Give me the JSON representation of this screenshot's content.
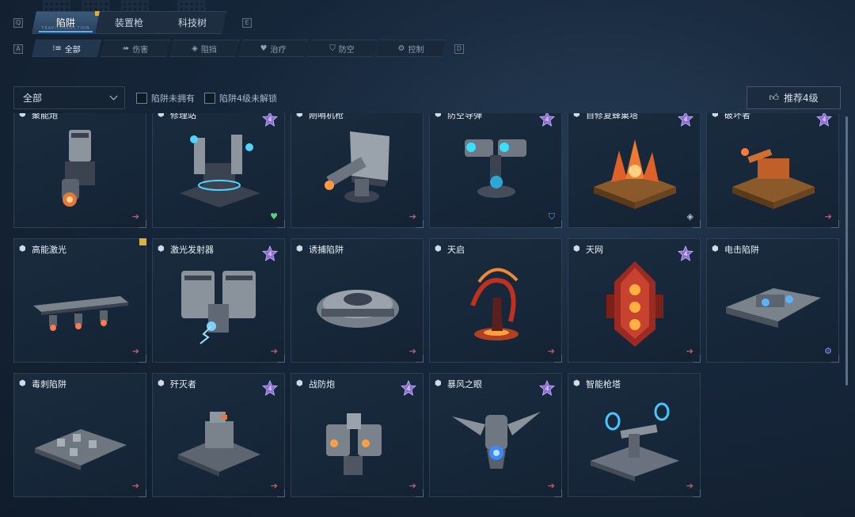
{
  "tabs": {
    "left_key": "Q",
    "right_key": "E",
    "items": [
      {
        "label": "陷阱",
        "sub": "TRAP/COLLECTION",
        "active": true,
        "badge": true
      },
      {
        "label": "装置枪",
        "sub": "",
        "active": false,
        "badge": false
      },
      {
        "label": "科技树",
        "sub": "",
        "active": false,
        "badge": false
      }
    ]
  },
  "filters": {
    "left_key": "A",
    "right_key": "D",
    "items": [
      {
        "label": "全部",
        "icon": "grid-icon",
        "glyph": "⁝≡",
        "active": true
      },
      {
        "label": "伤害",
        "icon": "damage-icon",
        "glyph": "➠",
        "active": false
      },
      {
        "label": "阻挡",
        "icon": "block-icon",
        "glyph": "◈",
        "active": false
      },
      {
        "label": "治疗",
        "icon": "heal-icon",
        "glyph": "♥",
        "active": false
      },
      {
        "label": "防空",
        "icon": "antiair-icon",
        "glyph": "⛉",
        "active": false
      },
      {
        "label": "控制",
        "icon": "control-icon",
        "glyph": "⚙",
        "active": false
      }
    ]
  },
  "toolbar": {
    "select_value": "全部",
    "check_not_owned": "陷阱未拥有",
    "check_level4_locked": "陷阱4级未解锁",
    "recommend_label": "推荐4级"
  },
  "cards": [
    {
      "name": "聚能炮",
      "star": false,
      "foot": "damage",
      "art": "cannon"
    },
    {
      "name": "修理站",
      "star": true,
      "foot": "heal",
      "art": "repair"
    },
    {
      "name": "刚哨机枪",
      "star": false,
      "foot": "damage",
      "art": "gun"
    },
    {
      "name": "防空导弹",
      "star": true,
      "foot": "antiair",
      "art": "missile"
    },
    {
      "name": "自修复蜂巢塔",
      "star": true,
      "foot": "block",
      "art": "hive"
    },
    {
      "name": "破坏者",
      "star": true,
      "foot": "damage",
      "art": "destroyer"
    },
    {
      "name": "高能激光",
      "star": false,
      "foot": "damage",
      "art": "laser",
      "new": true
    },
    {
      "name": "激光发射器",
      "star": true,
      "foot": "damage",
      "art": "emitter"
    },
    {
      "name": "诱捕陷阱",
      "star": false,
      "foot": "damage",
      "art": "lure"
    },
    {
      "name": "天启",
      "star": false,
      "foot": "damage",
      "art": "apocalypse"
    },
    {
      "name": "天网",
      "star": true,
      "foot": "damage",
      "art": "skynet"
    },
    {
      "name": "电击陷阱",
      "star": false,
      "foot": "control",
      "art": "shock"
    },
    {
      "name": "毒刺陷阱",
      "star": false,
      "foot": "damage",
      "art": "spike"
    },
    {
      "name": "歼灭者",
      "star": true,
      "foot": "damage",
      "art": "annihilator"
    },
    {
      "name": "战防炮",
      "star": true,
      "foot": "damage",
      "art": "atgun"
    },
    {
      "name": "暴风之眼",
      "star": true,
      "foot": "damage",
      "art": "storm"
    },
    {
      "name": "智能枪塔",
      "star": false,
      "foot": "damage",
      "art": "smartturret"
    }
  ],
  "star_level": "4",
  "colors": {
    "damage": "#e0505a",
    "heal": "#5fce7a",
    "antiair": "#5aa6ff",
    "block": "#b8c4d2",
    "control": "#9a8cff",
    "star": "#8a6ad8",
    "accent": "#53b0ff"
  }
}
